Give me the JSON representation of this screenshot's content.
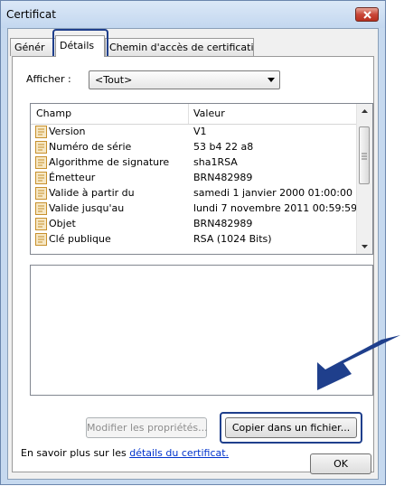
{
  "window": {
    "title": "Certificat"
  },
  "tabs": [
    {
      "label": "Génér"
    },
    {
      "label": "Détails"
    },
    {
      "label": "Chemin d'accès de certification"
    }
  ],
  "show": {
    "label": "Afficher :",
    "value": "<Tout>"
  },
  "list": {
    "headers": {
      "field": "Champ",
      "value": "Valeur"
    },
    "rows": [
      {
        "field": "Version",
        "value": "V1"
      },
      {
        "field": "Numéro de série",
        "value": "53 b4 22 a8"
      },
      {
        "field": "Algorithme de signature",
        "value": "sha1RSA"
      },
      {
        "field": "Émetteur",
        "value": "BRN482989"
      },
      {
        "field": "Valide à partir du",
        "value": "samedi 1 janvier 2000 01:00:00"
      },
      {
        "field": "Valide jusqu'au",
        "value": "lundi 7 novembre 2011 00:59:59"
      },
      {
        "field": "Objet",
        "value": "BRN482989"
      },
      {
        "field": "Clé publique",
        "value": "RSA (1024 Bits)"
      }
    ]
  },
  "buttons": {
    "edit_properties": "Modifier les propriétés...",
    "copy_to_file": "Copier dans un fichier...",
    "ok": "OK"
  },
  "footer": {
    "prefix": "En savoir plus sur les ",
    "link": "détails du certificat."
  },
  "colors": {
    "highlight": "#1f3f8c",
    "link": "#0033cc",
    "window_frame": "#c6d9ef"
  }
}
